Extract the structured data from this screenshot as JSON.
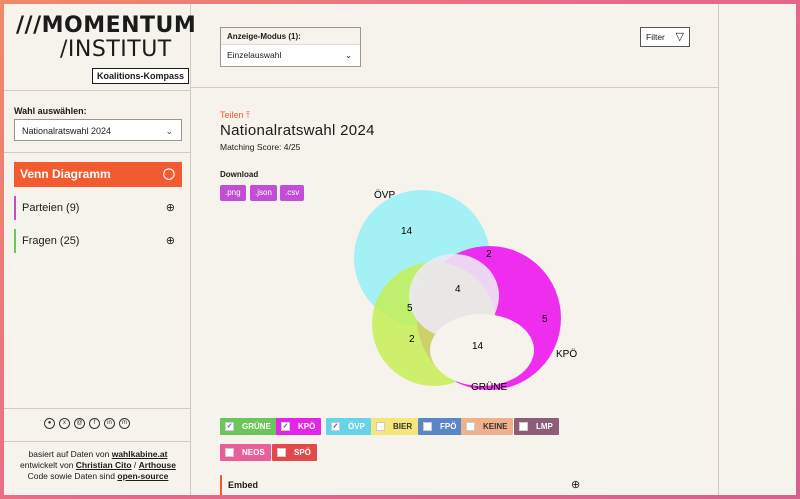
{
  "logo": {
    "line1": "///MOMENTUM",
    "line2": "/INSTITUT",
    "badge": "Koalitions-Kompass"
  },
  "sidebar": {
    "wahl_label": "Wahl auswählen:",
    "wahl_value": "Nationalratswahl 2024",
    "nav": [
      {
        "label": "Venn Diagramm",
        "icon": "venn-icon",
        "active": true
      },
      {
        "label": "Parteien (9)",
        "icon": "plus-circle-icon",
        "accent": "#c24ec0"
      },
      {
        "label": "Fragen (25)",
        "icon": "plus-circle-icon",
        "accent": "#6bc65a"
      }
    ],
    "socials": [
      "instagram-icon",
      "x-icon",
      "threads-icon",
      "facebook-icon",
      "linkedin-icon",
      "mastodon-icon"
    ],
    "credits": {
      "line1_prefix": "basiert auf Daten von ",
      "line1_link": "wahlkabine.at",
      "line2_prefix": "entwickelt von ",
      "line2_link1": "Christian Cito",
      "line2_sep": " / ",
      "line2_link2": "Arthouse",
      "line3_prefix": "Code sowie Daten sind ",
      "line3_link": "open-source"
    }
  },
  "header": {
    "mode_label": "Anzeige-Modus (1):",
    "mode_value": "Einzelauswahl",
    "filter_label": "Filter"
  },
  "main": {
    "share_label": "Teilen",
    "title": "Nationalratswahl 2024",
    "score": "Matching Score: 4/25",
    "download_label": "Download",
    "downloads": [
      ".png",
      ".json",
      ".csv"
    ],
    "embed_label": "Embed"
  },
  "venn": {
    "sets": [
      {
        "name": "ÖVP",
        "color": "#9ff0f5"
      },
      {
        "name": "KPÖ",
        "color": "#ee22ee"
      },
      {
        "name": "GRÜNE",
        "color": "#c6ee55"
      }
    ],
    "regions": {
      "ovp_only": "14",
      "ovp_kpo": "2",
      "all": "4",
      "ovp_grune": "5",
      "kpo_only": "5",
      "grune_only": "2",
      "kpo_grune": "14"
    }
  },
  "parties": [
    {
      "name": "GRÜNE",
      "color": "#6bc65a",
      "checked": true
    },
    {
      "name": "KPÖ",
      "color": "#e326e5",
      "checked": true
    },
    {
      "name": "ÖVP",
      "color": "#66d4e6",
      "checked": true
    },
    {
      "name": "BIER",
      "color": "#f6e67a",
      "checked": false
    },
    {
      "name": "FPÖ",
      "color": "#5b86c6",
      "checked": false
    },
    {
      "name": "KEINE",
      "color": "#f0b08c",
      "checked": false
    },
    {
      "name": "LMP",
      "color": "#8e5b79",
      "checked": false
    },
    {
      "name": "NEOS",
      "color": "#e8609a",
      "checked": false
    },
    {
      "name": "SPÖ",
      "color": "#e14a4a",
      "checked": false
    }
  ]
}
